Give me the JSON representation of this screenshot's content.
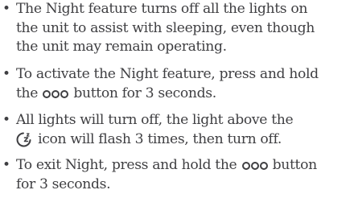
{
  "items": [
    {
      "lines": [
        "The Night feature turns off all the lights on",
        "the unit to assist with sleeping, even though",
        "the unit may remain operating."
      ]
    },
    {
      "line1": "To activate the Night feature, press and hold",
      "line2_pre": "the",
      "line2_post": "button for 3 seconds."
    },
    {
      "line1": "All lights will turn off, the light above the",
      "line2_post": "icon will flash 3 times, then turn off."
    },
    {
      "line1_pre": "To exit Night, press and hold the",
      "line1_post": "button",
      "line2": "for 3 seconds."
    }
  ],
  "icons": {
    "button": "three-dots-icon",
    "night": "moon-sleep-icon"
  },
  "colors": {
    "text": "#3f3f42"
  }
}
